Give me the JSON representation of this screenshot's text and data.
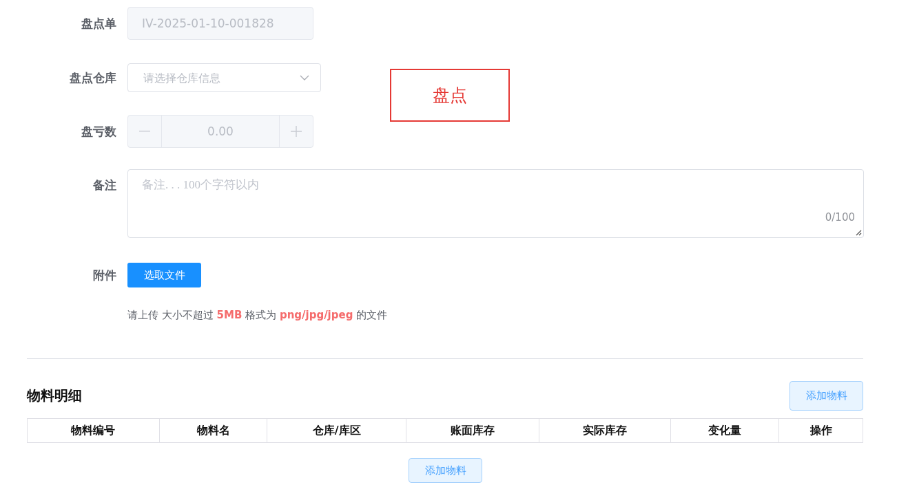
{
  "form": {
    "fields": [
      {
        "kind": "text",
        "label": "盘点单",
        "value": "IV-2025-01-10-001828",
        "disabled": true
      },
      {
        "kind": "select",
        "label": "盘点仓库",
        "placeholder": "请选择仓库信息"
      },
      {
        "kind": "number",
        "label": "盘亏数",
        "value": "0.00",
        "disabled": true
      },
      {
        "kind": "textarea",
        "label": "备注",
        "placeholder": "备注. . . 100个字符以内",
        "counter": "0/100"
      },
      {
        "kind": "upload",
        "label": "附件",
        "button": "选取文件",
        "hint": "请上传 大小不超过 **5MB** 格式为 **png/jpg/jpeg** 的文件"
      }
    ]
  },
  "annotation": {
    "text": "盘点"
  },
  "details": {
    "title": "物料明细",
    "add_button": "添加物料",
    "columns": [
      "物料编号",
      "物料名",
      "仓库/库区",
      "账面库存",
      "实际库存",
      "变化量",
      "操作"
    ],
    "bottom_button": "添加物料"
  }
}
